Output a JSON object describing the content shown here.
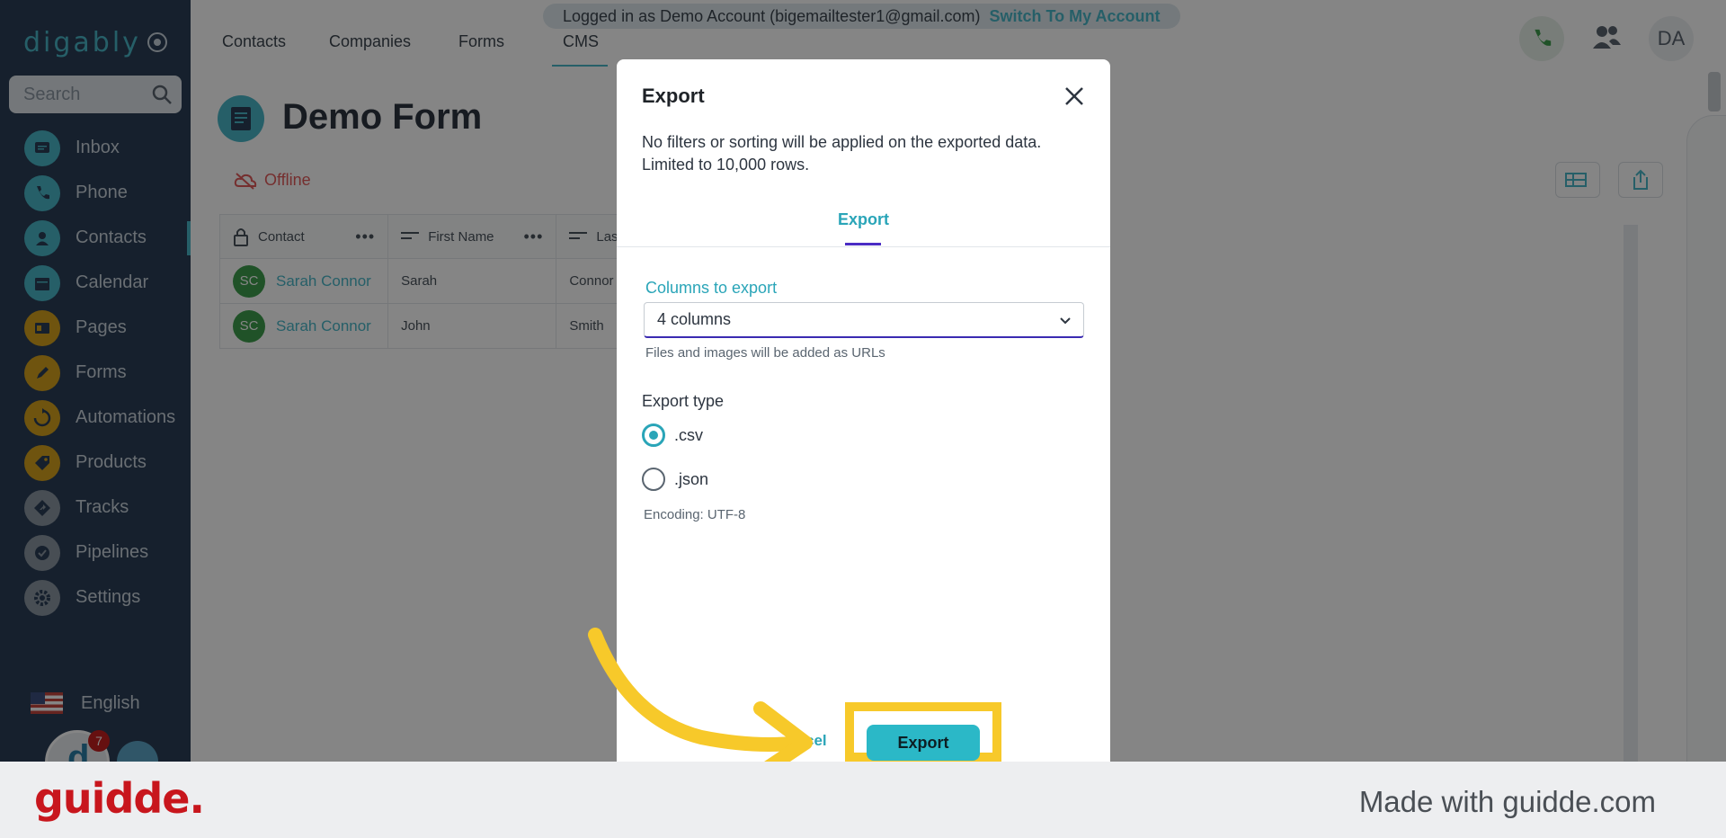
{
  "app": {
    "logo": "digably",
    "search_placeholder": "Search",
    "nav": [
      {
        "label": "Inbox",
        "icon": "inbox-icon",
        "color": "#49b6c7"
      },
      {
        "label": "Phone",
        "icon": "phone-icon",
        "color": "#49b6c7"
      },
      {
        "label": "Contacts",
        "icon": "contacts-icon",
        "color": "#49b6c7"
      },
      {
        "label": "Calendar",
        "icon": "calendar-icon",
        "color": "#49b6c7"
      },
      {
        "label": "Pages",
        "icon": "pages-icon",
        "color": "#d5a11e"
      },
      {
        "label": "Forms",
        "icon": "forms-icon",
        "color": "#d5a11e"
      },
      {
        "label": "Automations",
        "icon": "automations-icon",
        "color": "#d5a11e"
      },
      {
        "label": "Products",
        "icon": "products-icon",
        "color": "#d5a11e"
      },
      {
        "label": "Tracks",
        "icon": "tracks-icon",
        "color": "#8a96a2"
      },
      {
        "label": "Pipelines",
        "icon": "pipelines-icon",
        "color": "#8a96a2"
      },
      {
        "label": "Settings",
        "icon": "settings-icon",
        "color": "#8a96a2"
      }
    ],
    "language": "English",
    "notifications": "7"
  },
  "topbar": {
    "tabs": [
      "Contacts",
      "Companies",
      "Forms",
      "CMS"
    ],
    "login_text": "Logged in as Demo Account (bigemailtester1@gmail.com)",
    "switch_label": "Switch To My Account",
    "avatar": "DA"
  },
  "page": {
    "title": "Demo Form",
    "status": "Offline",
    "columns": [
      "Contact",
      "First Name",
      "Las"
    ],
    "rows": [
      {
        "initials": "SC",
        "contact": "Sarah Connor",
        "first": "Sarah",
        "last": "Connor"
      },
      {
        "initials": "SC",
        "contact": "Sarah Connor",
        "first": "John",
        "last": "Smith"
      }
    ]
  },
  "modal": {
    "title": "Export",
    "desc_line1": "No filters or sorting will be applied on the exported data.",
    "desc_line2": "Limited to 10,000 rows.",
    "tab": "Export",
    "columns_label": "Columns to export",
    "columns_value": "4 columns",
    "columns_help": "Files and images will be added as URLs",
    "type_label": "Export type",
    "option_csv": ".csv",
    "option_json": ".json",
    "encoding": "Encoding: UTF-8",
    "cancel": "cel",
    "export_button": "Export"
  },
  "footer": {
    "brand": "guidde.",
    "made_with": "Made with guidde.com"
  },
  "colors": {
    "accent": "#49b6c7",
    "highlight": "#f7c92a",
    "brand_red": "#c8161d"
  }
}
